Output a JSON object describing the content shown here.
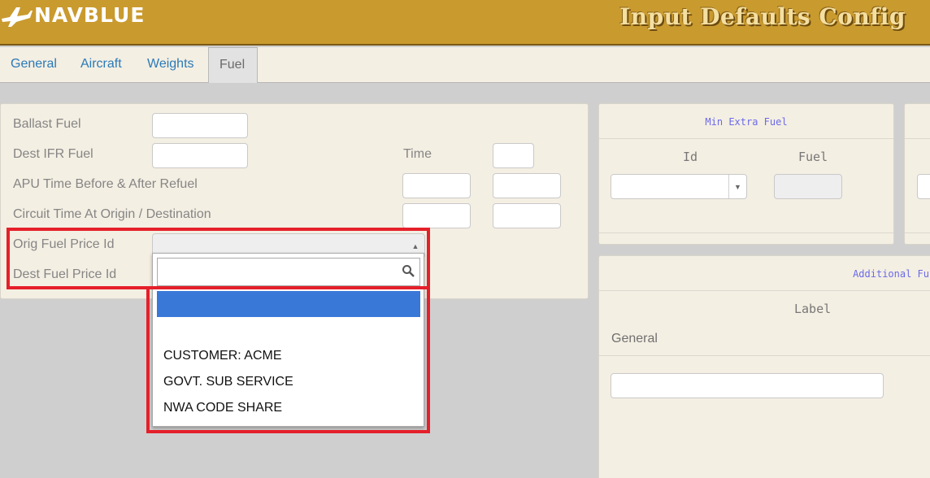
{
  "brand": {
    "logo_text": "NAVBLUE"
  },
  "header": {
    "title": "Input Defaults Config"
  },
  "tabs": [
    {
      "label": "General"
    },
    {
      "label": "Aircraft"
    },
    {
      "label": "Weights"
    },
    {
      "label": "Fuel"
    }
  ],
  "fuel_form": {
    "ballast_fuel": "Ballast Fuel",
    "dest_ifr_fuel": "Dest IFR Fuel",
    "time": "Time",
    "apu_time": "APU Time Before & After Refuel",
    "circuit_time": "Circuit Time At Origin / Destination",
    "orig_fuel_price_id": "Orig Fuel Price Id",
    "dest_fuel_price_id": "Dest Fuel Price Id"
  },
  "dropdown": {
    "search_value": "",
    "options": [
      "",
      "",
      "CUSTOMER: ACME",
      "GOVT. SUB SERVICE",
      "NWA CODE SHARE"
    ]
  },
  "min_extra_fuel": {
    "title": "Min Extra Fuel",
    "col_id": "Id",
    "col_fuel": "Fuel"
  },
  "additional_fuel": {
    "title": "Additional Fu",
    "col_label": "Label",
    "row_label": "General"
  },
  "colors": {
    "header_bg": "#c99a2e",
    "tab_link": "#2a7ab8",
    "panel_bg": "#f4efe3",
    "highlight": "#3a78d8",
    "annotation": "#e5202a"
  }
}
